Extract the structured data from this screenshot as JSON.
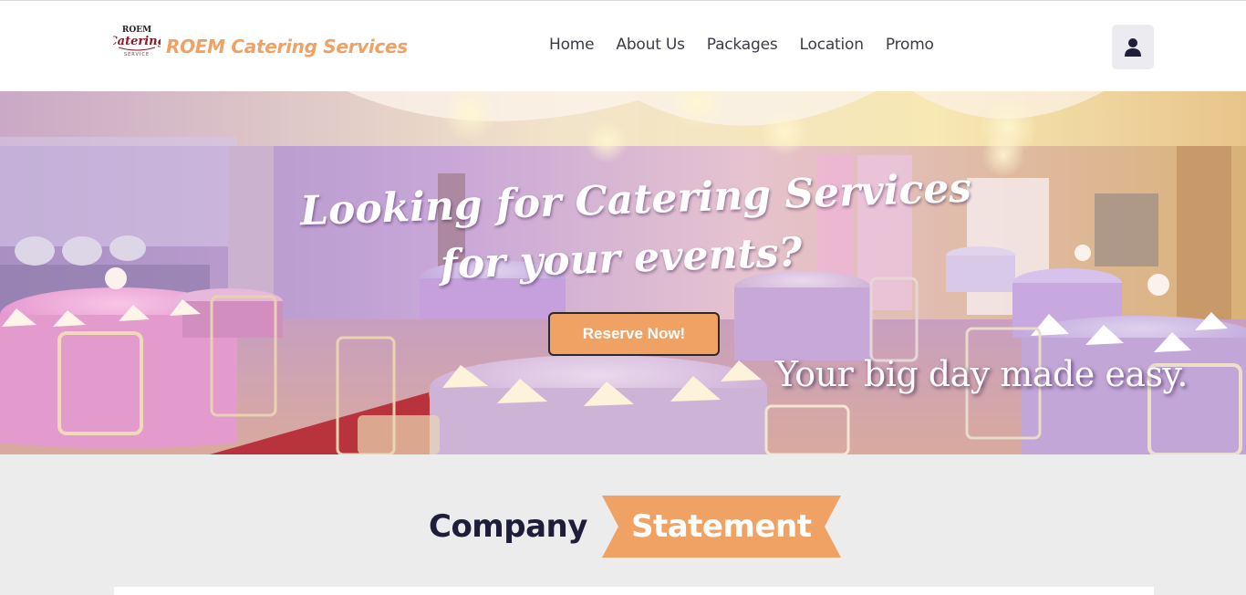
{
  "header": {
    "logo_text": "ROEM Catering Service",
    "brand_name": "ROEM Catering Services",
    "nav": [
      "Home",
      "About Us",
      "Packages",
      "Location",
      "Promo"
    ],
    "user_icon": "user-icon"
  },
  "hero": {
    "headline_line1": "Looking for Catering Services",
    "headline_line2": "for your events?",
    "cta_label": "Reserve Now!",
    "tagline": "Your big day made easy."
  },
  "statement": {
    "word1": "Company",
    "word2": "Statement"
  },
  "colors": {
    "accent": "#f0a264",
    "navy": "#1e1e3a",
    "page_bg": "#ececec"
  }
}
